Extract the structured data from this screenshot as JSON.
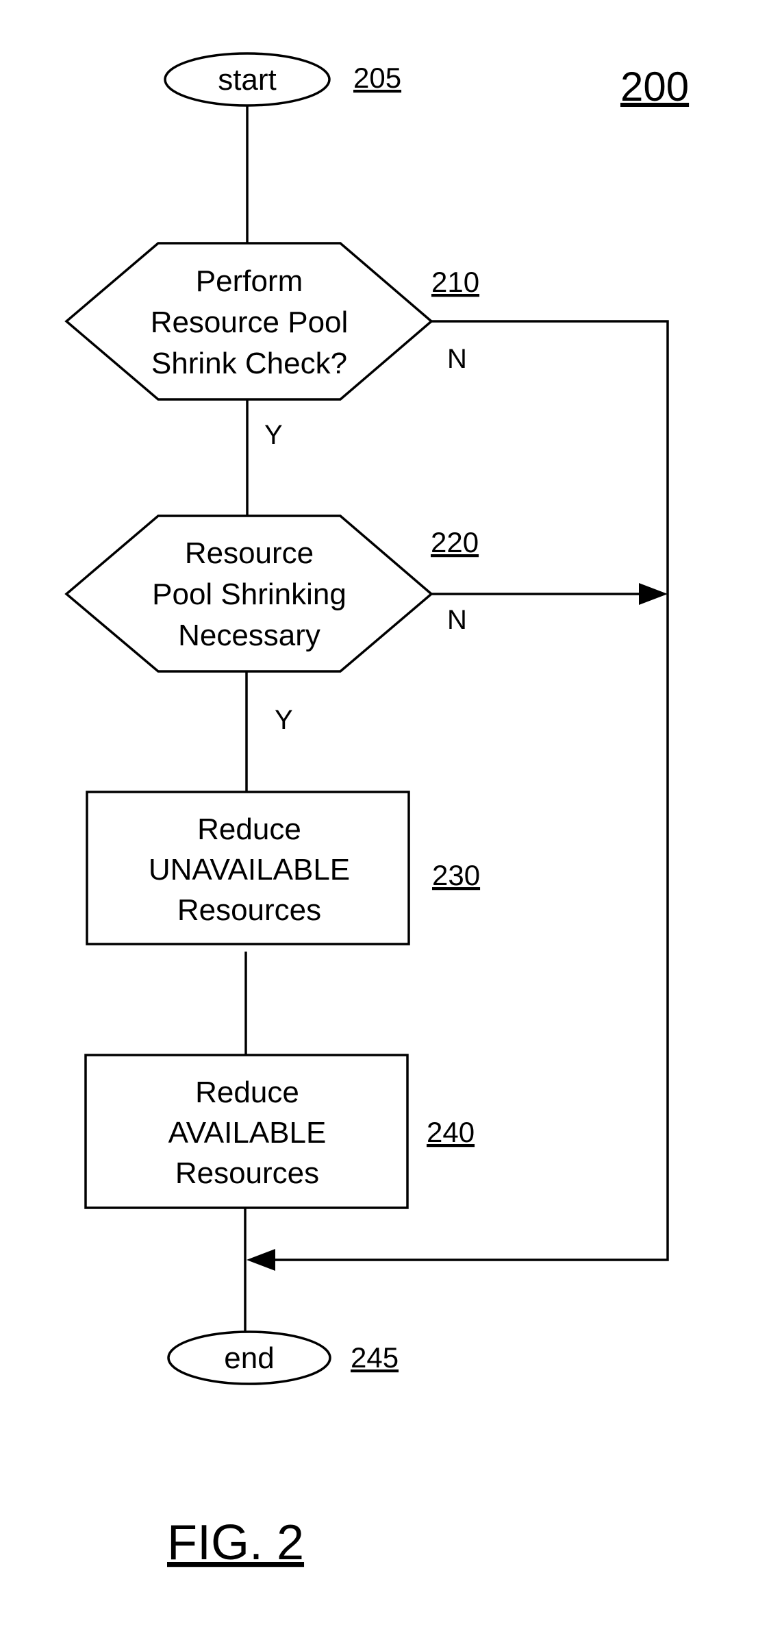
{
  "figure": {
    "number": "200",
    "caption": "FIG. 2"
  },
  "nodes": {
    "start": {
      "label": "start",
      "ref": "205"
    },
    "check": {
      "lines": [
        "Perform",
        "Resource Pool",
        "Shrink Check?"
      ],
      "ref": "210",
      "no_label": "N",
      "yes_label": "Y"
    },
    "necessary": {
      "lines": [
        "Resource",
        "Pool Shrinking",
        "Necessary"
      ],
      "ref": "220",
      "no_label": "N",
      "yes_label": "Y"
    },
    "reduce_unavailable": {
      "lines": [
        "Reduce",
        "UNAVAILABLE",
        "Resources"
      ],
      "ref": "230"
    },
    "reduce_available": {
      "lines": [
        "Reduce",
        "AVAILABLE",
        "Resources"
      ],
      "ref": "240"
    },
    "end": {
      "label": "end",
      "ref": "245"
    }
  }
}
